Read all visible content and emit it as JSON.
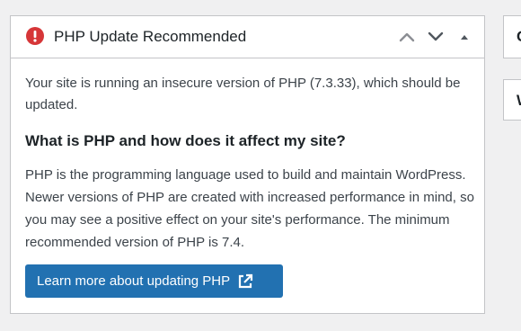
{
  "widget": {
    "title": "PHP Update Recommended",
    "intro": "Your site is running an insecure version of PHP (7.3.33), which should be updated.",
    "subheading": "What is PHP and how does it affect my site?",
    "description": "PHP is the programming language used to build and maintain WordPress. Newer versions of PHP are created with increased performance in mind, so you may see a positive effect on your site's performance. The minimum recommended version of PHP is 7.4.",
    "button_label": "Learn more about updating PHP"
  },
  "side_widgets": [
    {
      "label": "C"
    },
    {
      "label": "W"
    }
  ],
  "icons": {
    "alert": "alert-circle-icon",
    "move_up": "chevron-up-icon",
    "move_down": "chevron-down-icon",
    "toggle": "triangle-up-icon",
    "external": "external-link-icon"
  },
  "colors": {
    "alert": "#d63638",
    "button": "#2271b1",
    "background": "#f0f0f1"
  }
}
